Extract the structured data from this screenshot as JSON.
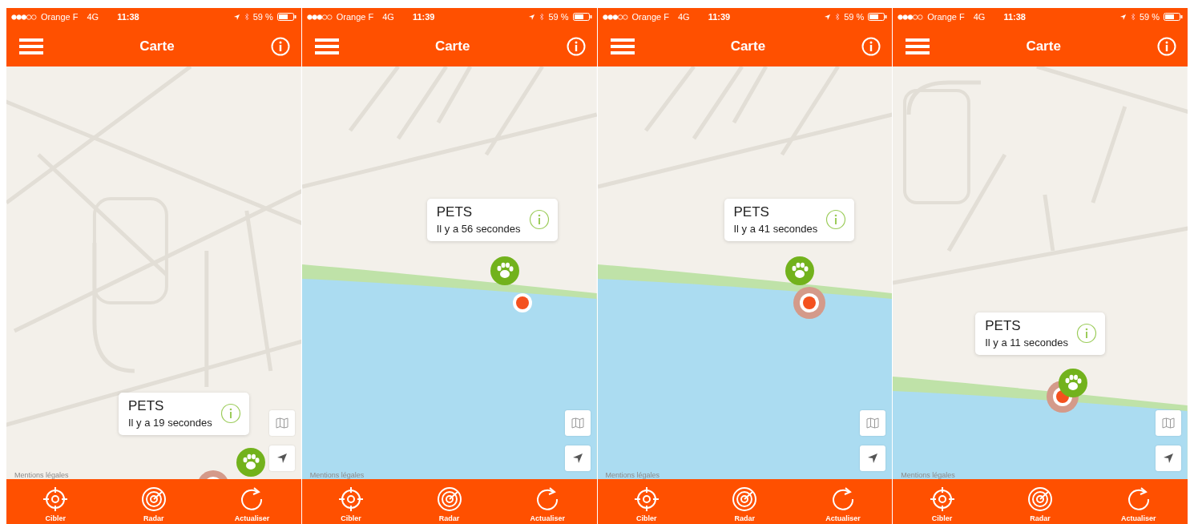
{
  "screens": [
    {
      "status_bar": {
        "carrier": "Orange F",
        "network": "4G",
        "time": "11:38",
        "battery": "59 %"
      },
      "title": "Carte",
      "callout": {
        "title": "PETS",
        "subtitle": "Il y a 19 secondes"
      },
      "location": {
        "halo": true
      },
      "legal_link": "Mentions légales",
      "tabs": [
        {
          "label": "Cibler",
          "kind": "target"
        },
        {
          "label": "Radar",
          "kind": "radar"
        },
        {
          "label": "Actualiser",
          "kind": "refresh"
        }
      ]
    },
    {
      "status_bar": {
        "carrier": "Orange F",
        "network": "4G",
        "time": "11:39",
        "battery": "59 %"
      },
      "title": "Carte",
      "callout": {
        "title": "PETS",
        "subtitle": "Il y a 56 secondes"
      },
      "location": {
        "halo": false
      },
      "legal_link": "Mentions légales",
      "tabs": [
        {
          "label": "Cibler",
          "kind": "target"
        },
        {
          "label": "Radar",
          "kind": "radar"
        },
        {
          "label": "Actualiser",
          "kind": "refresh"
        }
      ]
    },
    {
      "status_bar": {
        "carrier": "Orange F",
        "network": "4G",
        "time": "11:39",
        "battery": "59 %"
      },
      "title": "Carte",
      "callout": {
        "title": "PETS",
        "subtitle": "Il y a 41 secondes"
      },
      "location": {
        "halo": true
      },
      "legal_link": "Mentions légales",
      "tabs": [
        {
          "label": "Cibler",
          "kind": "target"
        },
        {
          "label": "Radar",
          "kind": "radar"
        },
        {
          "label": "Actualiser",
          "kind": "refresh"
        }
      ]
    },
    {
      "status_bar": {
        "carrier": "Orange F",
        "network": "4G",
        "time": "11:38",
        "battery": "59 %"
      },
      "title": "Carte",
      "callout": {
        "title": "PETS",
        "subtitle": "Il y a 11 secondes"
      },
      "location": {
        "halo": true
      },
      "legal_link": "Mentions légales",
      "tabs": [
        {
          "label": "Cibler",
          "kind": "target"
        },
        {
          "label": "Radar",
          "kind": "radar"
        },
        {
          "label": "Actualiser",
          "kind": "refresh"
        }
      ]
    }
  ]
}
